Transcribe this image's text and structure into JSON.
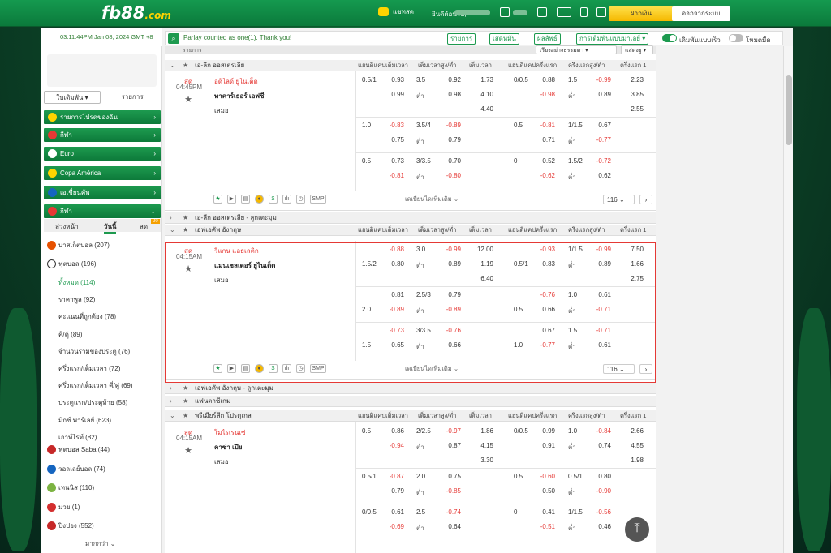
{
  "header": {
    "brand": "fb88",
    "brand_suffix": ".com",
    "chat": "แชทสด",
    "welcome": "ยินดีต้อนรับ,",
    "deposit": "ฝากเงิน",
    "logout": "ออกจากระบบ"
  },
  "toolbar": {
    "time": "03:11:44PM Jan 08, 2024 GMT +8",
    "notice": "Parlay counted as one(1). Thank you!",
    "b1": "รายการ",
    "b2": "เสดหมัน",
    "b3": "ผลลัพธ์",
    "b4": "การเดิมพันแบบมาเลย์",
    "fast": "เดิมพันแบบเร็ว",
    "mobile": "โหมดมืด"
  },
  "left": {
    "tab1": "ใบเดิมพัน",
    "tab2": "รายการ",
    "fav": "รายการโปรดของฉัน",
    "sport1": "กีฬา",
    "euro": "Euro",
    "copa": "Copa América",
    "asian": "เอเชี่ยนคัพ",
    "sport2": "กีฬา",
    "sub_tabs": [
      "ล่วงหน้า",
      "วันนี้",
      "สด"
    ],
    "live_count": "20",
    "sports": [
      {
        "name": "บาสเก็ตบอล",
        "count": "(207)"
      },
      {
        "name": "ฟุตบอล",
        "count": "(196)"
      }
    ],
    "soccer_sub": [
      {
        "name": "ทั้งหมด",
        "count": "(114)"
      },
      {
        "name": "ราคาพูล",
        "count": "(92)"
      },
      {
        "name": "คะแนนที่ถูกต้อง",
        "count": "(78)"
      },
      {
        "name": "คี่/คู่",
        "count": "(89)"
      },
      {
        "name": "จำนวนรวมของประตู",
        "count": "(76)"
      },
      {
        "name": "ครึ่งแรก/เต็มเวลา",
        "count": "(72)"
      },
      {
        "name": "ครึ่งแรก/เต็มเวลา คี่/คู่",
        "count": "(69)"
      },
      {
        "name": "ประตูแรก/ประตูท้าย",
        "count": "(58)"
      },
      {
        "name": "มิกซ์ พาร์เลย์",
        "count": "(623)"
      },
      {
        "name": "เอาท์ไรท์",
        "count": "(82)"
      }
    ],
    "sports2": [
      {
        "name": "ฟุตบอล Saba",
        "count": "(44)"
      },
      {
        "name": "วอลเลย์บอล",
        "count": "(74)"
      },
      {
        "name": "เทนนิส",
        "count": "(110)"
      },
      {
        "name": "มวย",
        "count": "(1)"
      },
      {
        "name": "ปิงปอง",
        "count": "(552)"
      }
    ],
    "more": "มากกว่า"
  },
  "main": {
    "title": "รายการ",
    "filter": "เรียงอย่างธรรมดา",
    "collapse": "แสดงฐ",
    "cols": [
      "แฮนดิแคปเต็มเวลา",
      "เต็มเวลาสูง/ต่ำ",
      "เต็มเวลา",
      "แฮนดิแคปครึ่งแรก",
      "ครึ่งแรกสูง/ต่ำ",
      "ครึ่งแรก 1"
    ],
    "leagues": [
      {
        "name": "เอ-ลีก ออสเตรเลีย"
      },
      {
        "name": "เอ-ลีก ออสเตรเลีย - ลูกเตะมุม"
      },
      {
        "name": "เอฟเอคัพ อังกฤษ"
      },
      {
        "name": "เอฟเอคัพ อังกฤษ - ลูกเตะมุม"
      },
      {
        "name": "แฟนตาซีเกม"
      },
      {
        "name": "พรีเมียร์ลีก โปรตุเกส"
      }
    ],
    "live": "สด",
    "draw": "เสมอ",
    "under": "ต่ำ",
    "more_bets": "เดเบียนไดเพิ่มเติม",
    "smp": "SMP",
    "matches": [
      {
        "time": "04:45PM",
        "home": "อดิไลด์ ยูไนเต็ด",
        "away": "ทาคาร์เธอร์ เอฟซี",
        "count": "116",
        "rows": [
          [
            "0.5/1",
            "0.93",
            "3.5",
            "0.92",
            "1.73",
            "0/0.5",
            "0.88",
            "1.5",
            "-0.99",
            "2.23"
          ],
          [
            "",
            "0.99",
            "ต่ำ",
            "0.98",
            "4.10",
            "",
            "-0.98",
            "ต่ำ",
            "0.89",
            "3.85"
          ],
          [
            "",
            "",
            "",
            "",
            "4.40",
            "",
            "",
            "",
            "",
            "2.55"
          ],
          [
            "1.0",
            "-0.83",
            "3.5/4",
            "-0.89",
            "",
            "0.5",
            "-0.81",
            "1/1.5",
            "0.67",
            ""
          ],
          [
            "",
            "0.75",
            "ต่ำ",
            "0.79",
            "",
            "",
            "0.71",
            "ต่ำ",
            "-0.77",
            ""
          ],
          [
            "0.5",
            "0.73",
            "3/3.5",
            "0.70",
            "",
            "0",
            "0.52",
            "1.5/2",
            "-0.72",
            ""
          ],
          [
            "",
            "-0.81",
            "ต่ำ",
            "-0.80",
            "",
            "",
            "-0.62",
            "ต่ำ",
            "0.62",
            ""
          ]
        ]
      },
      {
        "time": "04:15AM",
        "home": "วีแกน แอธเลติก",
        "away": "แมนเชสเตอร์ ยูไนเต็ด",
        "count": "116",
        "rows": [
          [
            "",
            "-0.88",
            "3.0",
            "-0.99",
            "12.00",
            "",
            "-0.93",
            "1/1.5",
            "-0.99",
            "7.50"
          ],
          [
            "1.5/2",
            "0.80",
            "ต่ำ",
            "0.89",
            "1.19",
            "0.5/1",
            "0.83",
            "ต่ำ",
            "0.89",
            "1.66"
          ],
          [
            "",
            "",
            "",
            "",
            "6.40",
            "",
            "",
            "",
            "",
            "2.75"
          ],
          [
            "",
            "0.81",
            "2.5/3",
            "0.79",
            "",
            "",
            "-0.76",
            "1.0",
            "0.61",
            ""
          ],
          [
            "2.0",
            "-0.89",
            "ต่ำ",
            "-0.89",
            "",
            "0.5",
            "0.66",
            "ต่ำ",
            "-0.71",
            ""
          ],
          [
            "",
            "-0.73",
            "3/3.5",
            "-0.76",
            "",
            "",
            "0.67",
            "1.5",
            "-0.71",
            ""
          ],
          [
            "1.5",
            "0.65",
            "ต่ำ",
            "0.66",
            "",
            "1.0",
            "-0.77",
            "ต่ำ",
            "0.61",
            ""
          ]
        ]
      },
      {
        "time": "04:15AM",
        "home": "โมไรเรนเซ่",
        "away": "คาซ่า เปีย",
        "rows": [
          [
            "0.5",
            "0.86",
            "2/2.5",
            "-0.97",
            "1.86",
            "0/0.5",
            "0.99",
            "1.0",
            "-0.84",
            "2.66"
          ],
          [
            "",
            "-0.94",
            "ต่ำ",
            "0.87",
            "4.15",
            "",
            "0.91",
            "ต่ำ",
            "0.74",
            "4.55"
          ],
          [
            "",
            "",
            "",
            "",
            "3.30",
            "",
            "",
            "",
            "",
            "1.98"
          ],
          [
            "0.5/1",
            "-0.87",
            "2.0",
            "0.75",
            "",
            "0.5",
            "-0.60",
            "0.5/1",
            "0.80",
            ""
          ],
          [
            "",
            "0.79",
            "ต่ำ",
            "-0.85",
            "",
            "",
            "0.50",
            "ต่ำ",
            "-0.90",
            ""
          ],
          [
            "0/0.5",
            "0.61",
            "2.5",
            "-0.74",
            "",
            "0",
            "0.41",
            "1/1.5",
            "-0.56",
            ""
          ],
          [
            "",
            "-0.69",
            "ต่ำ",
            "0.64",
            "",
            "",
            "-0.51",
            "ต่ำ",
            "0.46",
            ""
          ]
        ]
      }
    ]
  },
  "colors": {
    "green": "#1d9a4f",
    "red": "#e53935",
    "yellow": "#f5b800"
  }
}
